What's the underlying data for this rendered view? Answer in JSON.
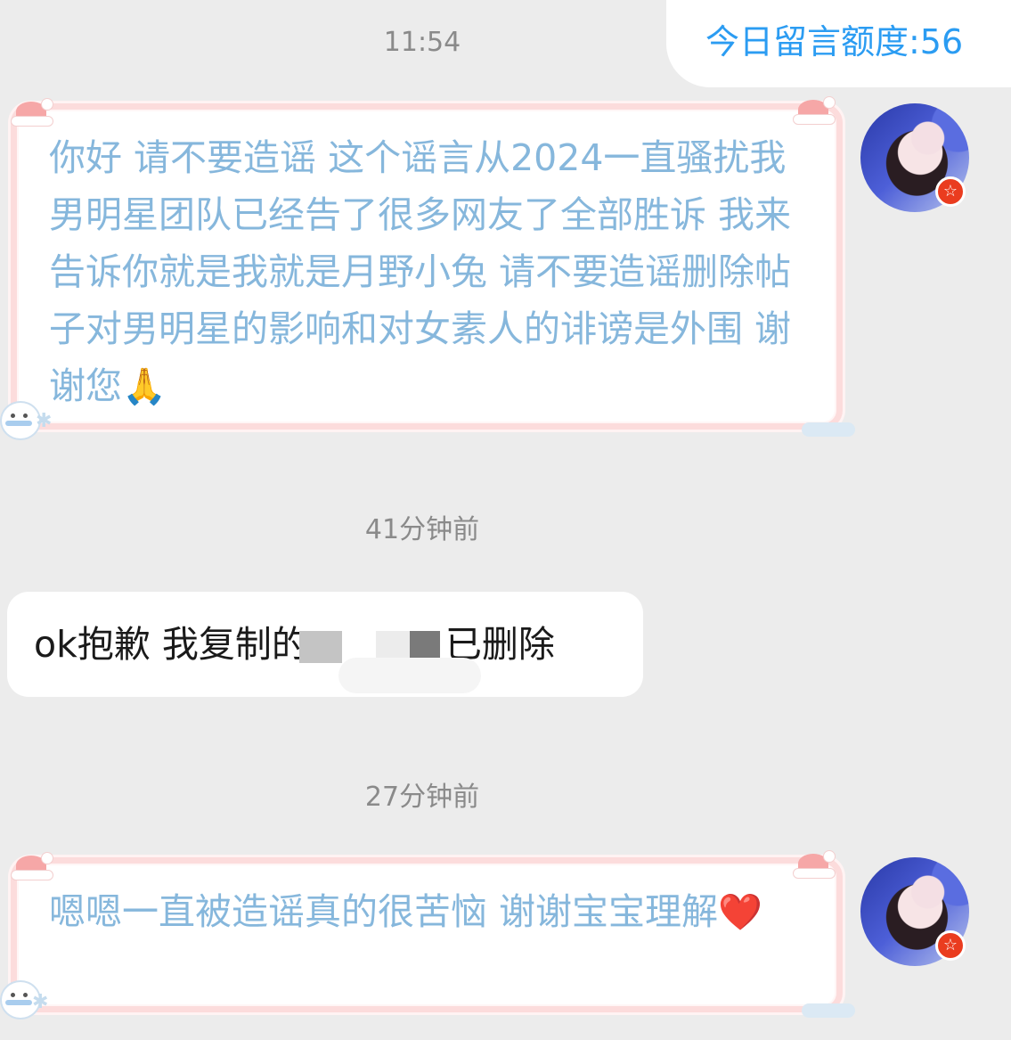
{
  "header": {
    "quota_text": "今日留言额度:56"
  },
  "messages": [
    {
      "timestamp": "11:54",
      "text": "你好 请不要造谣 这个谣言从2024一直骚扰我 男明星团队已经告了很多网友了全部胜诉 我来告诉你就是我就是月野小兔 请不要造谣删除帖子对男明星的影响和对女素人的诽谤是外围 谢谢您",
      "emoji": "🙏"
    },
    {
      "timestamp": "41分钟前",
      "text_before": "ok抱歉 我复制的",
      "text_after": "已删除"
    },
    {
      "timestamp": "27分钟前",
      "text": "嗯嗯一直被造谣真的很苦恼 谢谢宝宝理解",
      "emoji": "❤️"
    }
  ],
  "icons": {
    "avatar": "avatar-photo",
    "badge": "star-badge-icon",
    "badge_glyph": "☆"
  },
  "colors": {
    "page_bg": "#ececec",
    "quota_text": "#2b9cf2",
    "incoming_text": "#86b7dc",
    "outgoing_text": "#1a1a1a",
    "bubble_border": "#fcdcdc",
    "badge": "#ea3c1f"
  }
}
